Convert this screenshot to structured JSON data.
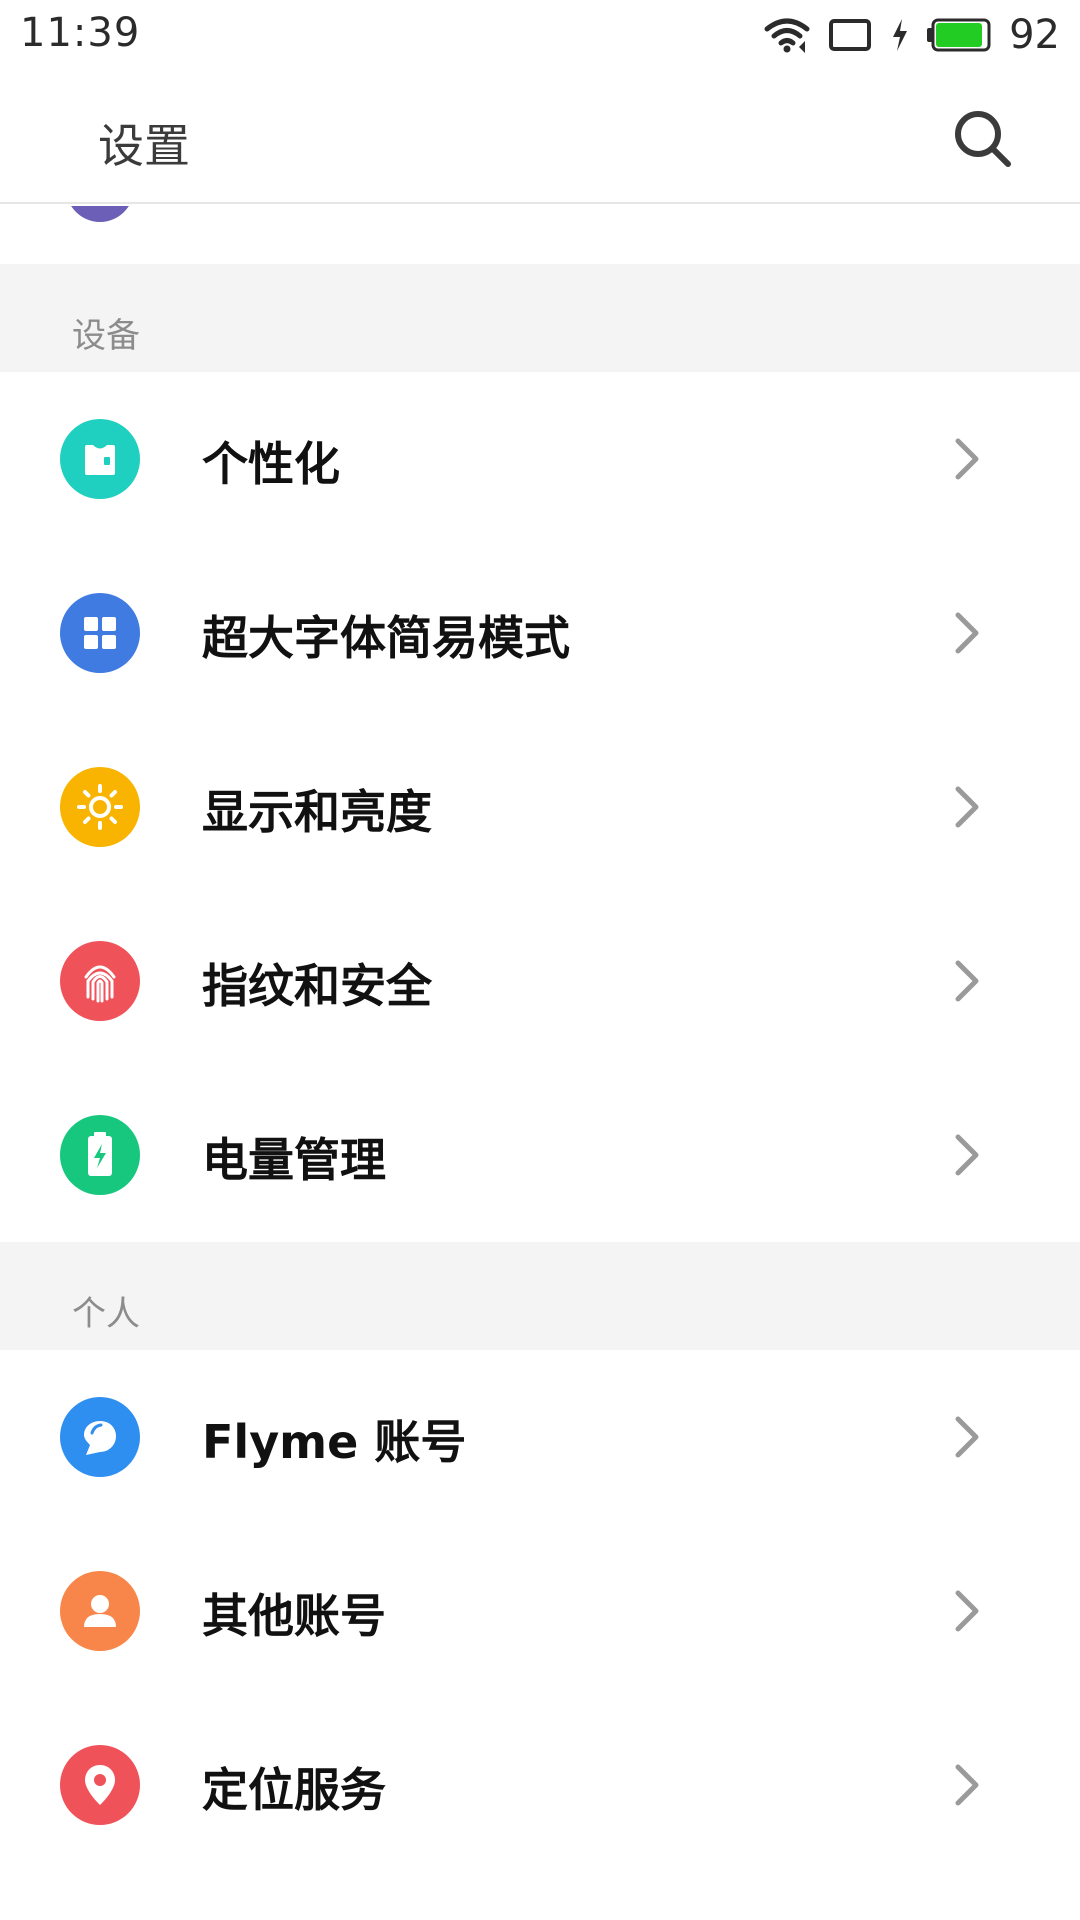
{
  "status_bar": {
    "time": "11:39",
    "battery_percent": "92",
    "battery_fill": 0.92,
    "icons": [
      "wifi-icon",
      "screen-icon",
      "charging-icon",
      "battery-icon"
    ]
  },
  "app_bar": {
    "title": "设置",
    "search_icon": "search-icon"
  },
  "sections": [
    {
      "header": "设备",
      "items": [
        {
          "label": "个性化",
          "icon": "personalize-icon",
          "color": "#1fcfbf"
        },
        {
          "label": "超大字体简易模式",
          "icon": "grid-icon",
          "color": "#3f7be0"
        },
        {
          "label": "显示和亮度",
          "icon": "sun-icon",
          "color": "#f8b400"
        },
        {
          "label": "指纹和安全",
          "icon": "fingerprint-icon",
          "color": "#f0525a"
        },
        {
          "label": "电量管理",
          "icon": "battery-power-icon",
          "color": "#17c77d"
        }
      ]
    },
    {
      "header": "个人",
      "items": [
        {
          "label": "Flyme 账号",
          "icon": "flyme-icon",
          "color": "#2f8ff0"
        },
        {
          "label": "其他账号",
          "icon": "account-icon",
          "color": "#f8864a"
        },
        {
          "label": "定位服务",
          "icon": "location-icon",
          "color": "#f0525a"
        }
      ]
    }
  ],
  "colors": {
    "section_bg": "#f4f4f4",
    "chevron": "#9a9a9a",
    "partial_icon": "#6b5fb7"
  }
}
